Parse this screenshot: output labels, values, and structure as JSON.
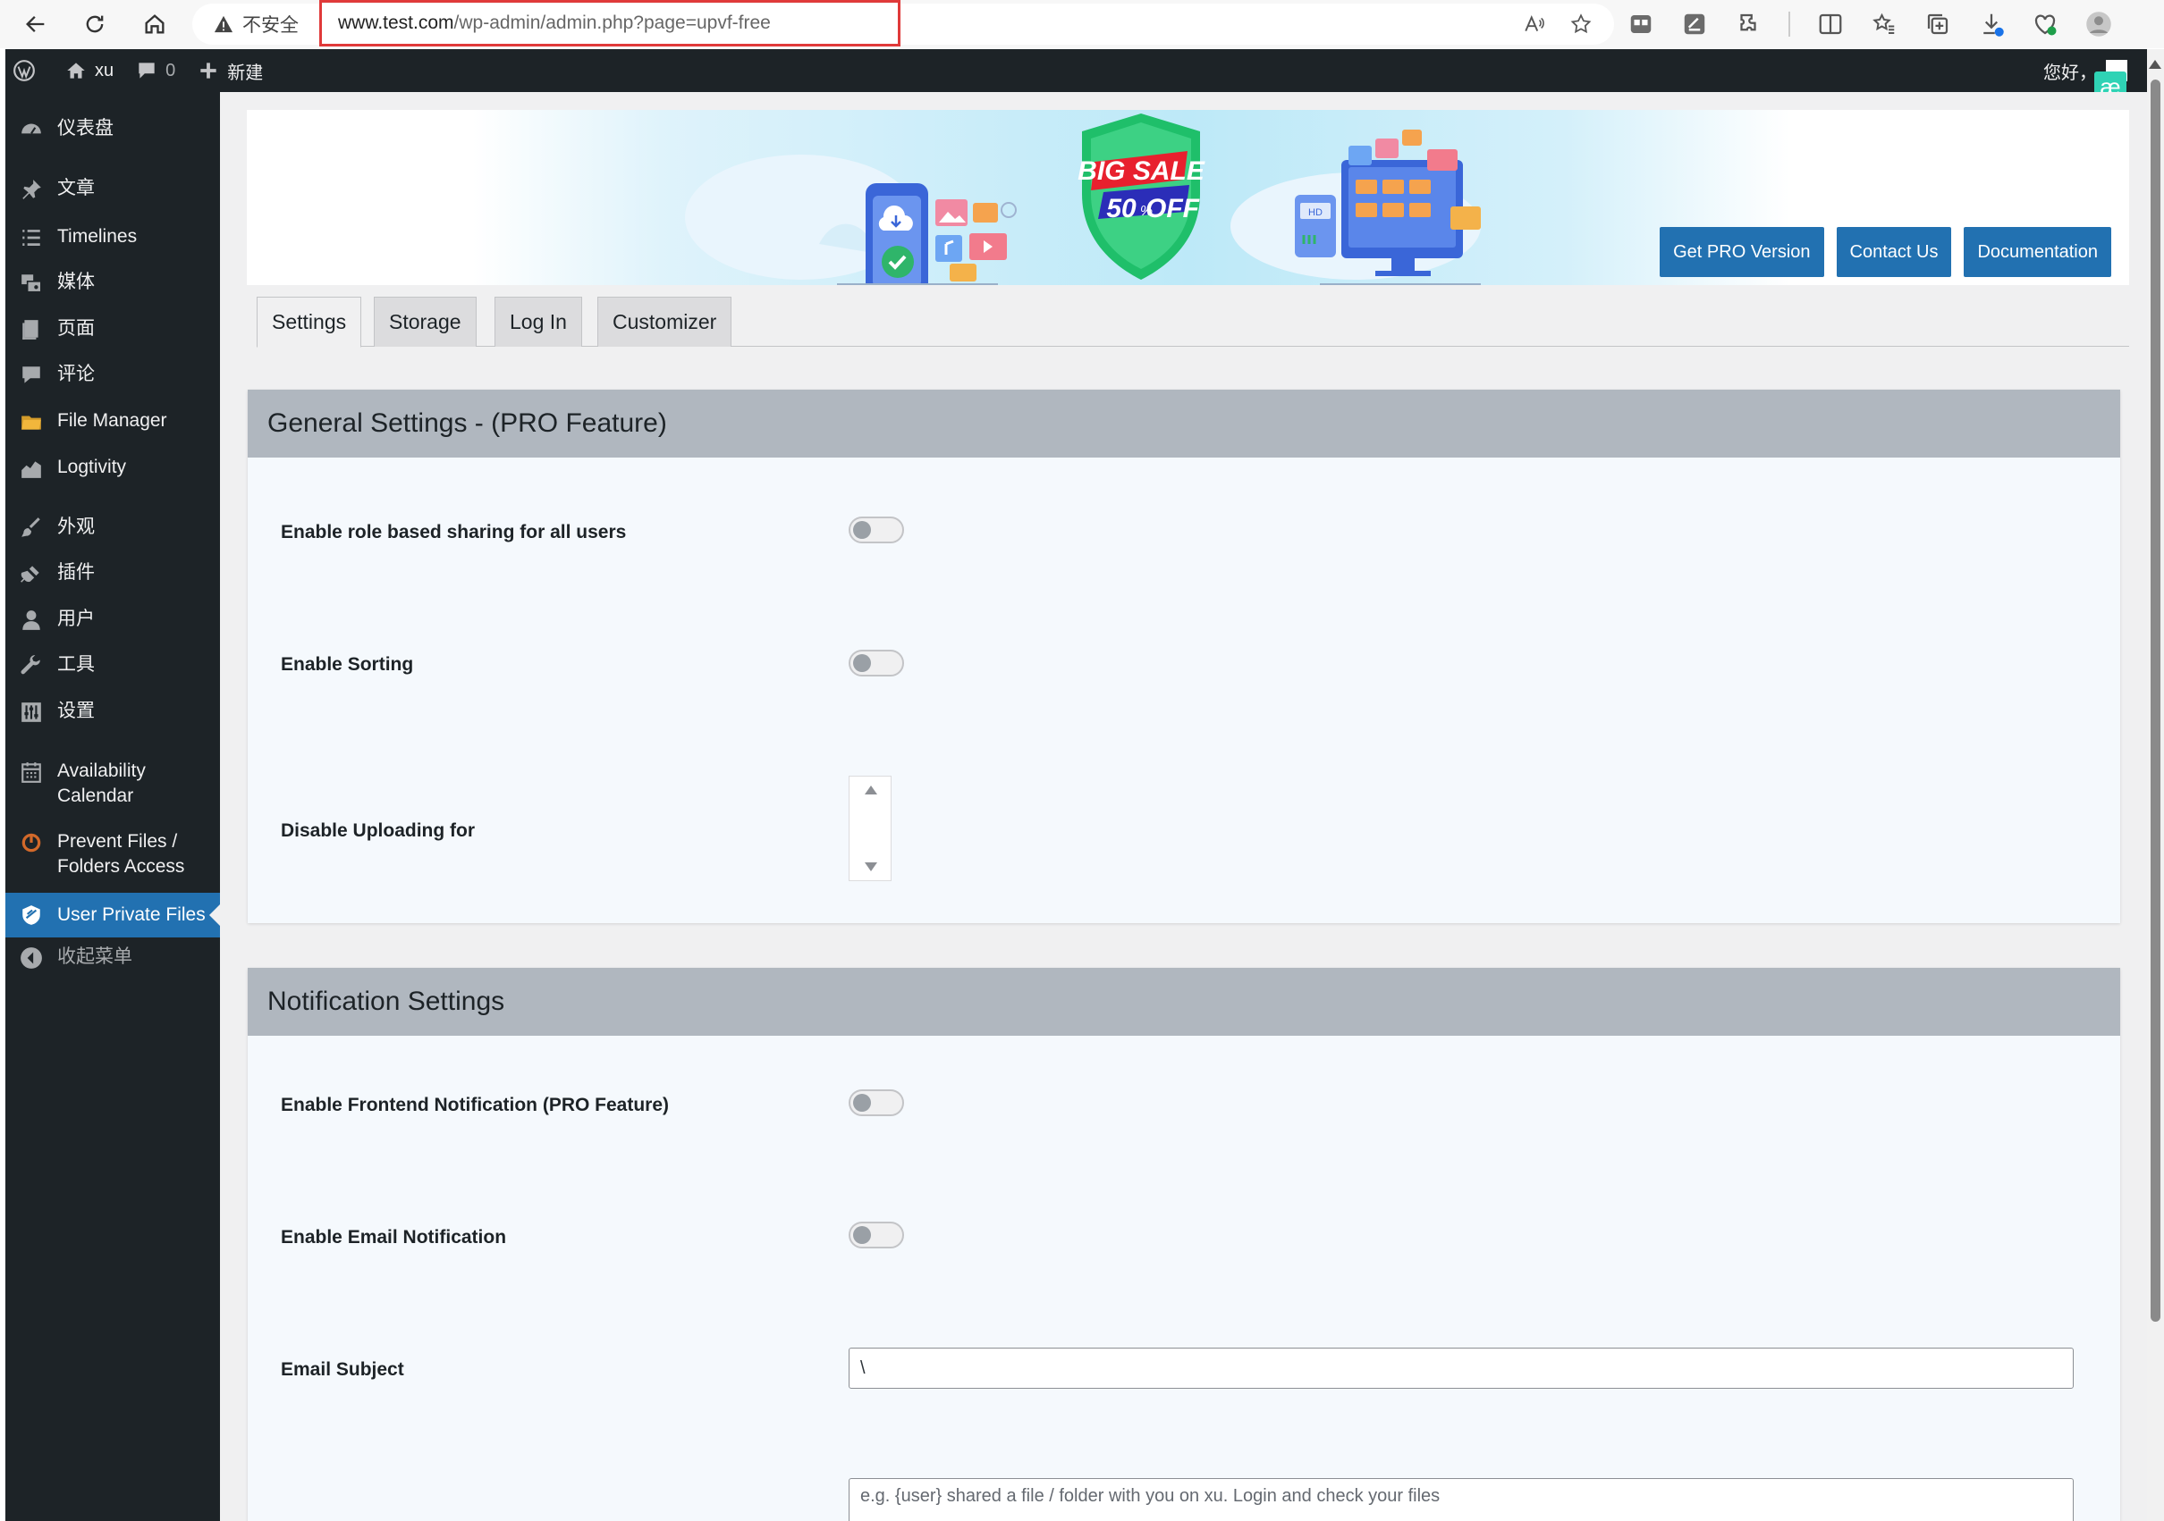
{
  "browser": {
    "security_label": "不安全",
    "url_host": "www.test.com",
    "url_path": "/wp-admin/admin.php?page=upvf-free"
  },
  "adminbar": {
    "site_name": "xu",
    "comments_count": "0",
    "new_label": "新建",
    "greeting": "您好，",
    "badge_text": "æ"
  },
  "sidebar": {
    "items": [
      {
        "label": "仪表盘",
        "icon": "dashboard-icon"
      },
      {
        "label": "文章",
        "icon": "pin-icon"
      },
      {
        "label": "Timelines",
        "icon": "list-icon"
      },
      {
        "label": "媒体",
        "icon": "media-icon"
      },
      {
        "label": "页面",
        "icon": "page-icon"
      },
      {
        "label": "评论",
        "icon": "comment-icon"
      },
      {
        "label": "File Manager",
        "icon": "folder-icon"
      },
      {
        "label": "Logtivity",
        "icon": "chart-icon"
      },
      {
        "label": "外观",
        "icon": "brush-icon"
      },
      {
        "label": "插件",
        "icon": "plug-icon"
      },
      {
        "label": "用户",
        "icon": "user-icon"
      },
      {
        "label": "工具",
        "icon": "wrench-icon"
      },
      {
        "label": "设置",
        "icon": "settings-icon"
      },
      {
        "label": "Availability Calendar",
        "icon": "calendar-icon"
      },
      {
        "label": "Prevent Files / Folders Access",
        "icon": "prevent-icon"
      },
      {
        "label": "User Private Files",
        "icon": "shield-icon"
      },
      {
        "label": "收起菜单",
        "icon": "collapse-icon"
      }
    ]
  },
  "banner": {
    "sale_line1": "BIG SALE",
    "sale_line2": "50",
    "sale_pct": "%",
    "sale_off": "OFF",
    "hd_label": "HD",
    "buttons": [
      "Get PRO Version",
      "Contact Us",
      "Documentation"
    ]
  },
  "tabs": [
    "Settings",
    "Storage",
    "Log In",
    "Customizer"
  ],
  "general": {
    "title": "General Settings - (PRO Feature)",
    "role_sharing_label": "Enable role based sharing for all users",
    "sorting_label": "Enable Sorting",
    "disable_upload_label": "Disable Uploading for"
  },
  "notification": {
    "title": "Notification Settings",
    "frontend_label": "Enable Frontend Notification (PRO Feature)",
    "email_label": "Enable Email Notification",
    "subject_label": "Email Subject",
    "subject_value": "\\",
    "message_placeholder": "e.g. {user} shared a file / folder with you on xu. Login and check your files"
  },
  "colors": {
    "admin_dark": "#1d2327",
    "accent_blue": "#2271b1",
    "card_header": "#b0b7bf",
    "url_highlight": "#e03a3a"
  }
}
